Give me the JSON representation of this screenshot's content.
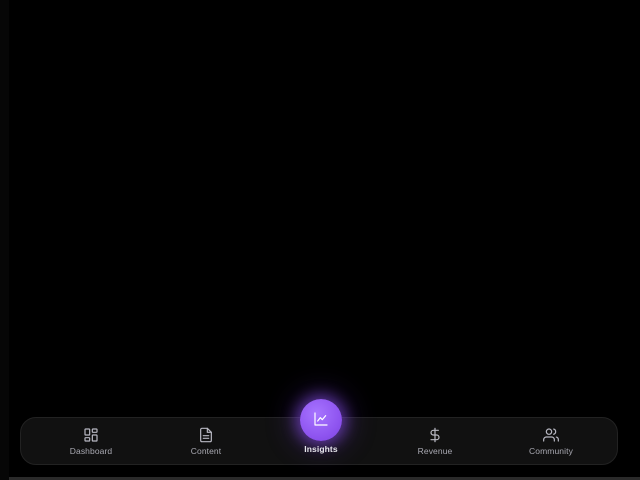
{
  "theme": {
    "background": "#000000",
    "nav_background": "#111111",
    "accent": "#9b5cf6",
    "label_color": "#a9a9b2",
    "active_label_color": "#e6e6ec"
  },
  "bottom_nav": {
    "active": "insights",
    "items": [
      {
        "id": "dashboard",
        "label": "Dashboard",
        "icon": "grid-icon"
      },
      {
        "id": "content",
        "label": "Content",
        "icon": "document-icon"
      },
      {
        "id": "insights",
        "label": "Insights",
        "icon": "line-chart-icon"
      },
      {
        "id": "revenue",
        "label": "Revenue",
        "icon": "dollar-icon"
      },
      {
        "id": "community",
        "label": "Community",
        "icon": "users-icon"
      }
    ]
  }
}
